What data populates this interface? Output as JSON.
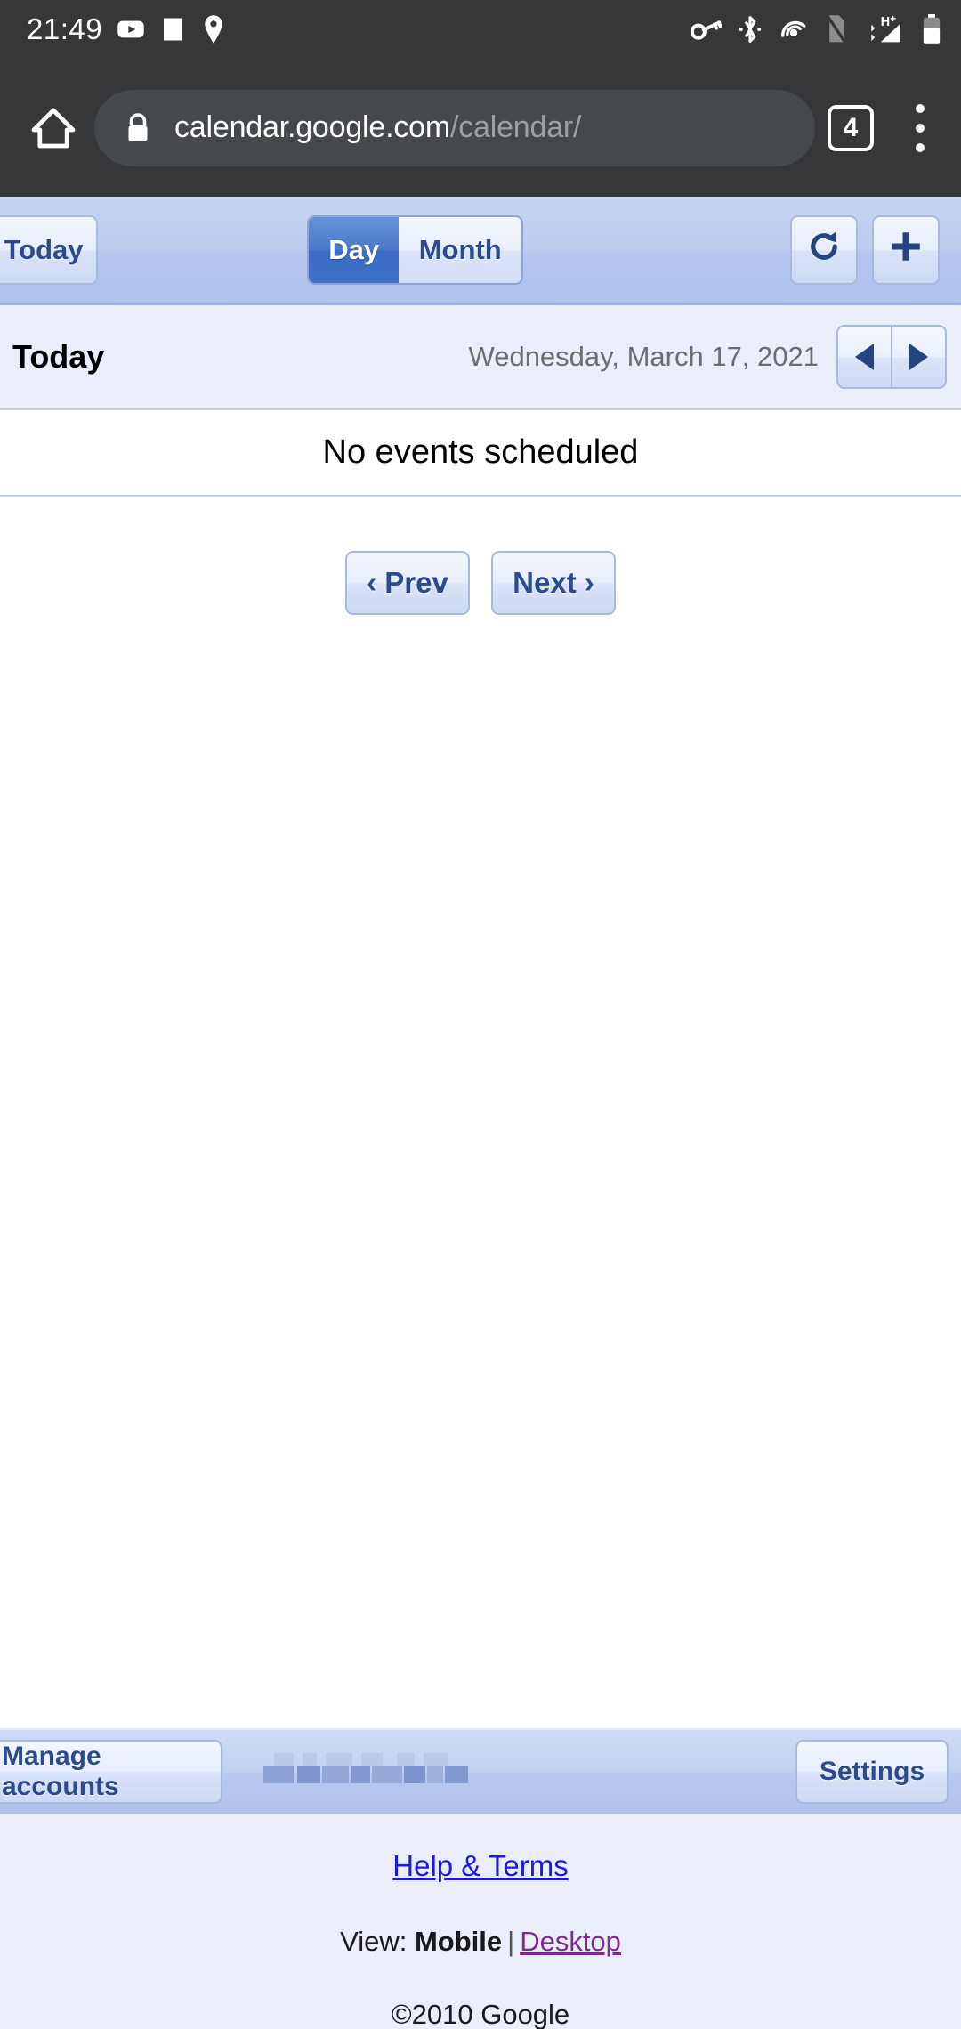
{
  "status_bar": {
    "time": "21:49",
    "left_icons": [
      "youtube-icon",
      "white-square-icon",
      "location-pin-icon"
    ],
    "right_icons": [
      "vpn-key-icon",
      "bluetooth-icon",
      "hotspot-icon",
      "no-sim-icon",
      "hplus-signal-icon",
      "battery-icon"
    ]
  },
  "browser": {
    "home_icon": "home-icon",
    "lock_icon": "lock-icon",
    "url_domain": "calendar.google.com",
    "url_path": "/calendar/",
    "tab_count": "4",
    "menu_icon": "kebab-menu-icon"
  },
  "toolbar": {
    "today_label": "Today",
    "view_day": "Day",
    "view_month": "Month",
    "selected_view": "Day",
    "refresh_icon": "refresh-icon",
    "add_icon": "plus-icon"
  },
  "date_header": {
    "today_label": "Today",
    "date_text": "Wednesday, March 17, 2021",
    "prev_icon": "triangle-left-icon",
    "next_icon": "triangle-right-icon"
  },
  "main": {
    "empty_message": "No events scheduled",
    "prev_label": "‹ Prev",
    "next_label": "Next ›"
  },
  "account_bar": {
    "manage_label": "Manage accounts",
    "settings_label": "Settings",
    "account_email": ""
  },
  "footer": {
    "help_label": "Help & Terms",
    "view_prefix": "View:",
    "view_current": "Mobile",
    "view_separator": "|",
    "view_other": "Desktop",
    "copyright": "©2010 Google"
  },
  "colors": {
    "status_bar_bg": "#353739",
    "toolbar_bg": "#bdcdf0",
    "accent_blue": "#4a78c9",
    "button_text": "#2a4b8d",
    "link_blue": "#1a1ae6",
    "link_visited": "#7b2a8f",
    "date_text": "#6d6d6d"
  }
}
